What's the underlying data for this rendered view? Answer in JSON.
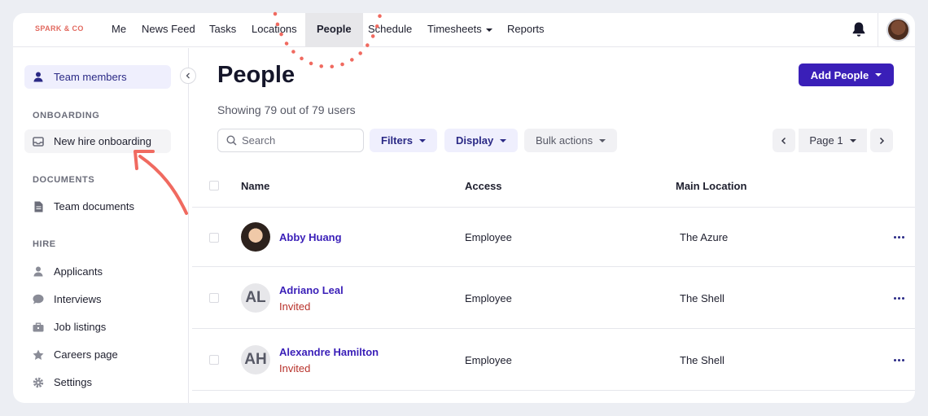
{
  "app": {
    "brand": "SPARK & CO"
  },
  "nav": {
    "items": [
      "Me",
      "News Feed",
      "Tasks",
      "Locations",
      "People",
      "Schedule",
      "Timesheets",
      "Reports"
    ],
    "active": "People"
  },
  "sidebar": {
    "team_members": "Team members",
    "sections": {
      "onboarding": "ONBOARDING",
      "documents": "DOCUMENTS",
      "hire": "HIRE"
    },
    "new_hire_onboarding": "New hire onboarding",
    "team_documents": "Team documents",
    "hire_items": [
      "Applicants",
      "Interviews",
      "Job listings",
      "Careers page",
      "Settings"
    ]
  },
  "main": {
    "title": "People",
    "subtitle": "Showing 79 out of 79 users",
    "add_button": "Add People",
    "search_placeholder": "Search",
    "filters": "Filters",
    "display": "Display",
    "bulk_actions": "Bulk actions",
    "page": "Page 1"
  },
  "table": {
    "columns": [
      "Name",
      "Access",
      "Main Location"
    ],
    "rows": [
      {
        "name": "Abby Huang",
        "initials": "",
        "status": "",
        "access": "Employee",
        "location": "The Azure"
      },
      {
        "name": "Adriano Leal",
        "initials": "AL",
        "status": "Invited",
        "access": "Employee",
        "location": "The Shell"
      },
      {
        "name": "Alexandre Hamilton",
        "initials": "AH",
        "status": "Invited",
        "access": "Employee",
        "location": "The Shell"
      }
    ]
  },
  "colors": {
    "brand": "#e2695f",
    "primary": "#3a1fb8",
    "invited": "#b8322b",
    "annotation": "#f06a60"
  }
}
